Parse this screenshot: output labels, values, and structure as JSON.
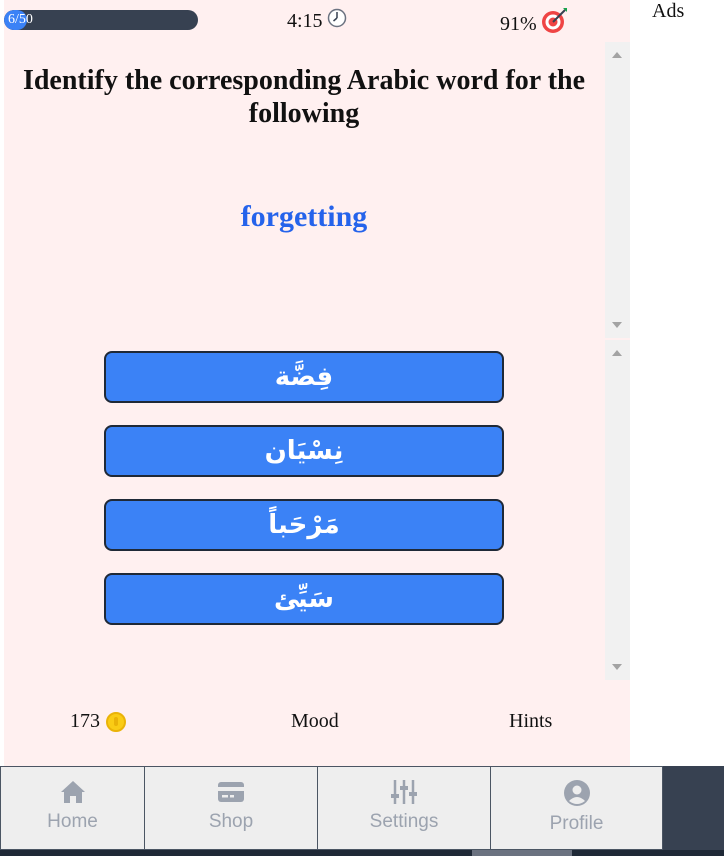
{
  "progress": {
    "label": "6/50",
    "fraction": 0.12
  },
  "timer": {
    "value": "4:15",
    "icon": "clock-icon"
  },
  "accuracy": {
    "value": "91%",
    "icon": "target-icon"
  },
  "ads": {
    "label": "Ads"
  },
  "question": {
    "prompt": "Identify the corresponding Arabic word for the following",
    "word": "forgetting"
  },
  "options": [
    {
      "label": "فِضَّة"
    },
    {
      "label": "نِسْيَان"
    },
    {
      "label": "مَرْحَباً"
    },
    {
      "label": "سَيِّئ"
    }
  ],
  "footer": {
    "coins": "173",
    "coin_icon": "coin-icon",
    "mood": "Mood",
    "hints": "Hints"
  },
  "nav": [
    {
      "label": "Home",
      "icon": "home-icon"
    },
    {
      "label": "Shop",
      "icon": "credit-card-icon"
    },
    {
      "label": "Settings",
      "icon": "sliders-icon"
    },
    {
      "label": "Profile",
      "icon": "user-circle-icon"
    }
  ],
  "colors": {
    "accent": "#3b82f6",
    "word": "#2563eb",
    "background": "#fff0f0",
    "nav_dark": "#374151"
  }
}
